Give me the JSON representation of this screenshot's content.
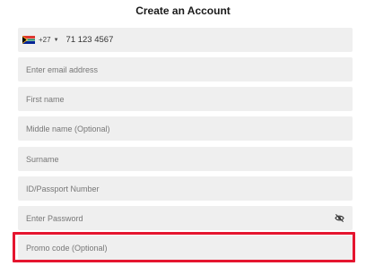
{
  "page": {
    "title": "Create an Account"
  },
  "phone": {
    "country_code": "+27",
    "value": "71 123 4567"
  },
  "fields": {
    "email": {
      "placeholder": "Enter email address"
    },
    "first_name": {
      "placeholder": "First name"
    },
    "middle_name": {
      "placeholder": "Middle name (Optional)"
    },
    "surname": {
      "placeholder": "Surname"
    },
    "id_passport": {
      "placeholder": "ID/Passport Number"
    },
    "password": {
      "placeholder": "Enter Password"
    },
    "promo": {
      "placeholder": "Promo code (Optional)"
    }
  },
  "icons": {
    "flag": "south-africa-flag-icon",
    "caret": "caret-down-icon",
    "eye": "eye-slash-icon"
  },
  "colors": {
    "field_bg": "#efefef",
    "highlight": "#e5152f"
  }
}
